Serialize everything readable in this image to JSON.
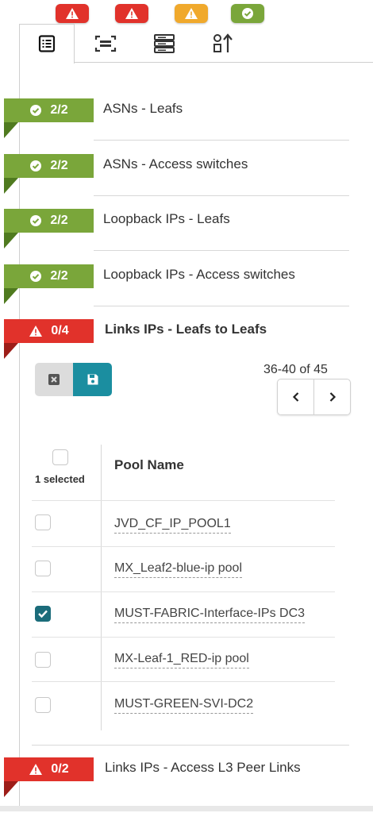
{
  "colors": {
    "success": "#7aa63a",
    "danger": "#e1322b",
    "warning": "#f0a92c",
    "teal": "#1b8ea0"
  },
  "top_badges": [
    {
      "status": "error",
      "icon": "warning-icon",
      "color": "#e1322b"
    },
    {
      "status": "error",
      "icon": "warning-icon",
      "color": "#e1322b"
    },
    {
      "status": "warning",
      "icon": "warning-icon",
      "color": "#f0a92c"
    },
    {
      "status": "ok",
      "icon": "check-circle-icon",
      "color": "#7aa63a"
    }
  ],
  "tabs": [
    {
      "icon": "list-icon",
      "active": true
    },
    {
      "icon": "scan-frame-icon",
      "active": false
    },
    {
      "icon": "server-stack-icon",
      "active": false
    },
    {
      "icon": "sort-icon",
      "active": false
    }
  ],
  "sections": [
    {
      "count": "2/2",
      "title": "ASNs - Leafs",
      "status": "ok"
    },
    {
      "count": "2/2",
      "title": "ASNs - Access switches",
      "status": "ok"
    },
    {
      "count": "2/2",
      "title": "Loopback IPs - Leafs",
      "status": "ok"
    },
    {
      "count": "2/2",
      "title": "Loopback IPs - Access switches",
      "status": "ok"
    },
    {
      "count": "0/4",
      "title": "Links IPs - Leafs to Leafs",
      "status": "error"
    },
    {
      "count": "0/2",
      "title": "Links IPs - Access L3 Peer Links",
      "status": "error"
    }
  ],
  "toolbar": {
    "cancel_icon": "close-box-icon",
    "save_icon": "save-icon"
  },
  "pagination": {
    "range": "36-40 of 45",
    "prev": "‹",
    "next": "›"
  },
  "table": {
    "selected_label": "1 selected",
    "column": "Pool Name",
    "rows": [
      {
        "name": "JVD_CF_IP_POOL1",
        "checked": false
      },
      {
        "name": "MX_Leaf2-blue-ip pool",
        "checked": false
      },
      {
        "name": "MUST-FABRIC-Interface-IPs DC3",
        "checked": true
      },
      {
        "name": "MX-Leaf-1_RED-ip pool",
        "checked": false
      },
      {
        "name": "MUST-GREEN-SVI-DC2",
        "checked": false
      }
    ]
  }
}
